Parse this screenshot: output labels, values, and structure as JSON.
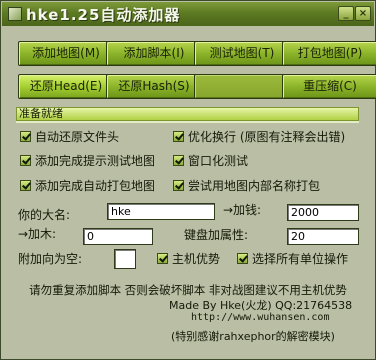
{
  "window": {
    "title": "hke1.25自动添加器",
    "minimize_icon": "minimize-icon",
    "close_icon": "close-icon",
    "minimize_glyph": "_",
    "close_glyph": "×"
  },
  "buttons": {
    "row1": [
      "添加地图(M)",
      "添加脚本(I)",
      "测试地图(T)",
      "打包地图(P)"
    ],
    "row2": [
      "还原Head(E)",
      "还原Hash(S)",
      "",
      "重压缩(C)"
    ]
  },
  "status": "准备就绪",
  "options": [
    {
      "label": "自动还原文件头",
      "checked": true
    },
    {
      "label": "优化换行 (原图有注释会出错)",
      "checked": true
    },
    {
      "label": "添加完成提示测试地图",
      "checked": true
    },
    {
      "label": "窗口化测试",
      "checked": true
    },
    {
      "label": "添加完成自动打包地图",
      "checked": true
    },
    {
      "label": "尝试用地图内部名称打包",
      "checked": true
    }
  ],
  "form": {
    "name_label": "你的大名:",
    "name_value": "hke",
    "add_money_label": "→加钱:",
    "add_money_value": "2000",
    "add_wood_label": "→加木:",
    "add_wood_value": "0",
    "keyboard_attr_label": "键盘加属性:",
    "keyboard_attr_value": "20",
    "attach_empty_label": "附加向为空:",
    "attach_empty_value": "",
    "host_advantage_label": "主机优势",
    "host_advantage_checked": true,
    "select_all_label": "选择所有单位操作",
    "select_all_checked": true
  },
  "footer": {
    "warning": "请勿重复添加脚本 否则会破坏脚本 非对战图建议不用主机优势",
    "credit": "Made By Hke(火龙) QQ:21764538",
    "url": "http://www.wuhansen.com",
    "thanks": "(特别感谢rahxephor的解密模块)"
  },
  "colors": {
    "accent_green": "#8cb42a",
    "titlebar": "#5d7a22",
    "background": "#b9bea4"
  }
}
